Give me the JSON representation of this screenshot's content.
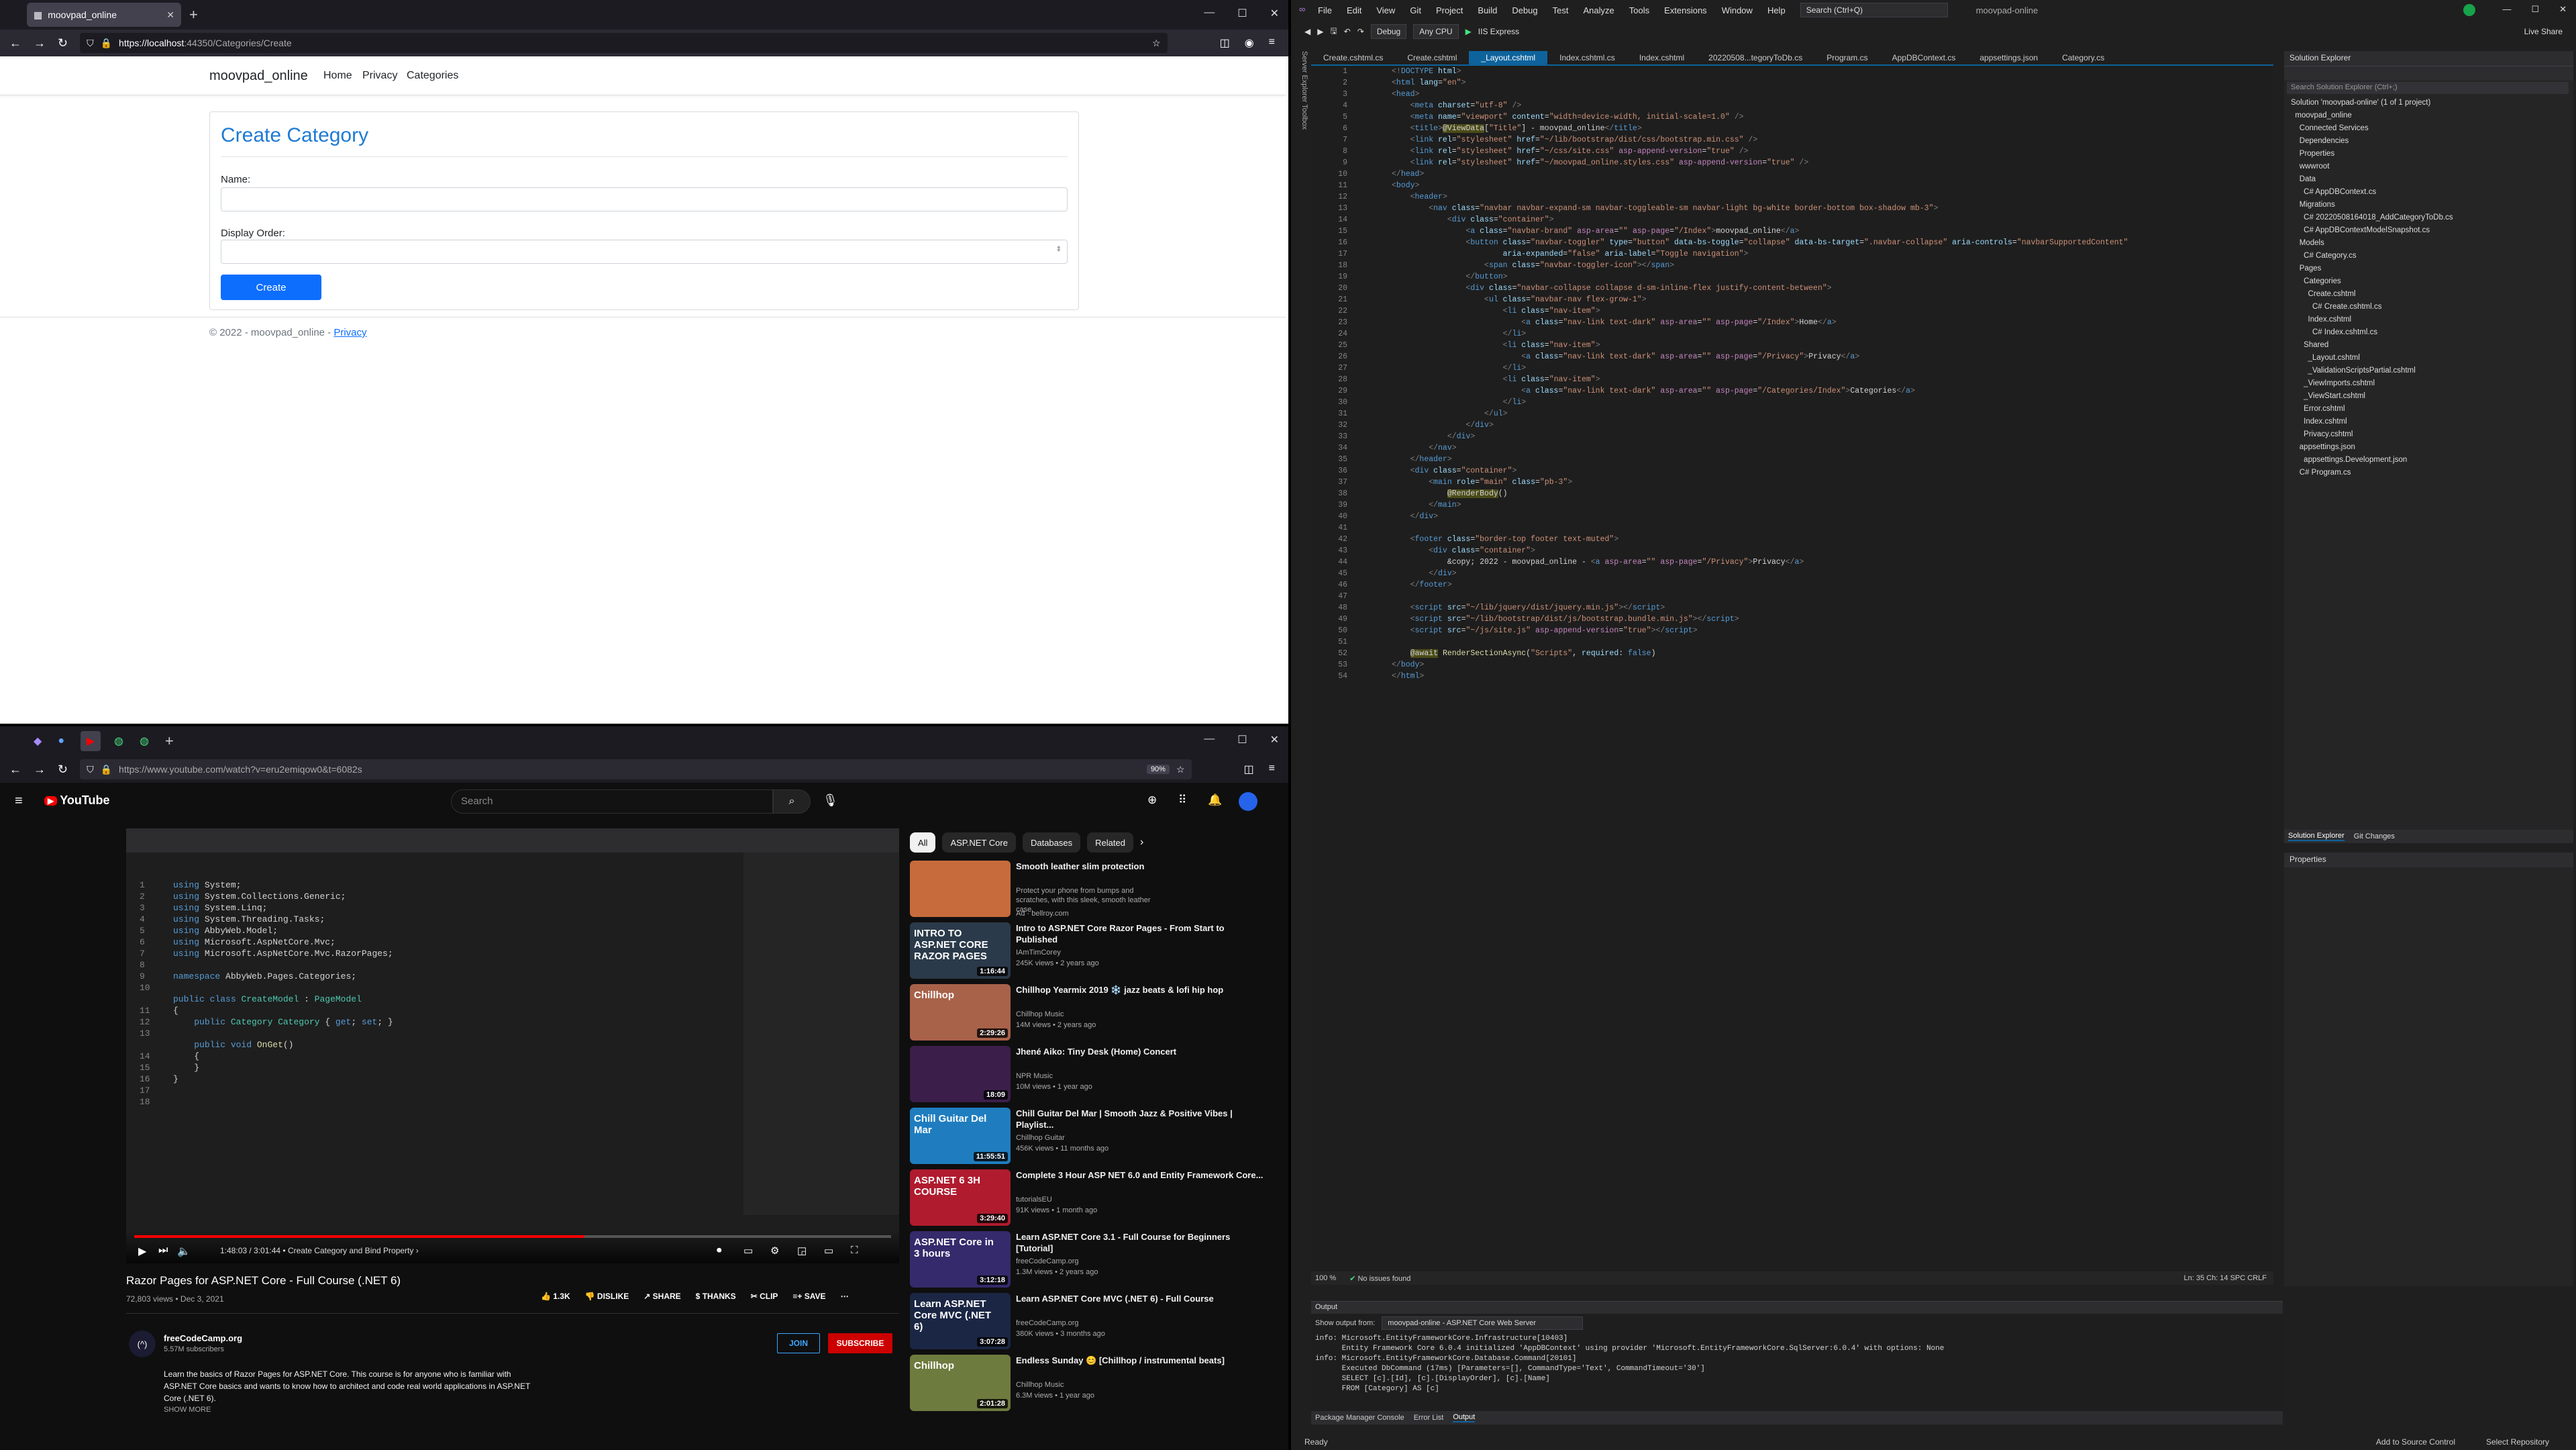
{
  "top_browser": {
    "tab_title": "moovpad_online",
    "url_host": "https://localhost",
    "url_rest": ":44350/Categories/Create",
    "page": {
      "brand": "moovpad_online",
      "nav": [
        "Home",
        "Privacy",
        "Categories"
      ],
      "heading": "Create Category",
      "name_label": "Name:",
      "order_label": "Display Order:",
      "create_button": "Create",
      "footer_text": "© 2022 - moovpad_online - ",
      "footer_link": "Privacy"
    }
  },
  "youtube": {
    "url": "https://www.youtube.com/watch?v=eru2emiqow0&t=6082s",
    "zoom": "90%",
    "search_placeholder": "Search",
    "chips": [
      "All",
      "ASP.NET Core",
      "Databases",
      "Related"
    ],
    "video_title": "Razor Pages for ASP.NET Core - Full Course (.NET 6)",
    "views": "72,803 views • Dec 3, 2021",
    "likes": "1.3K",
    "dislike": "DISLIKE",
    "share": "SHARE",
    "thanks": "THANKS",
    "clip": "CLIP",
    "save": "SAVE",
    "channel": "freeCodeCamp.org",
    "subscribers": "5.57M subscribers",
    "join": "JOIN",
    "subscribe": "SUBSCRIBE",
    "description": "Learn the basics of Razor Pages for ASP.NET Core. This course is for anyone who is familiar with ASP.NET Core basics and wants to know how to architect and code real world applications in ASP.NET Core (.NET 6).",
    "show_more": "SHOW MORE",
    "time": "1:48:03 / 3:01:44",
    "chapter": "Create Category and Bind Property",
    "recommendations": [
      {
        "title": "Smooth leather slim protection",
        "sub1": "Protect your phone from bumps and scratches, with this sleek, smooth leather case.",
        "sub2": "Ad · bellroy.com",
        "duration": "",
        "color": "#c86b3c",
        "thumb_text": ""
      },
      {
        "title": "Intro to ASP.NET Core Razor Pages - From Start to Published",
        "sub1": "IAmTimCorey",
        "sub2": "245K views • 2 years ago",
        "duration": "1:16:44",
        "color": "#2b3a4a",
        "thumb_text": "INTRO TO ASP.NET CORE RAZOR PAGES"
      },
      {
        "title": "Chillhop Yearmix 2019 ❄️ jazz beats & lofi hip hop",
        "sub1": "Chillhop Music",
        "sub2": "14M views • 2 years ago",
        "duration": "2:29:26",
        "color": "#a8624a",
        "thumb_text": "Chillhop"
      },
      {
        "title": "Jhené Aiko: Tiny Desk (Home) Concert",
        "sub1": "NPR Music",
        "sub2": "10M views • 1 year ago",
        "duration": "18:09",
        "color": "#3b1e4a",
        "thumb_text": ""
      },
      {
        "title": "Chill Guitar Del Mar | Smooth Jazz & Positive Vibes | Playlist...",
        "sub1": "Chillhop Guitar",
        "sub2": "456K views • 11 months ago",
        "duration": "11:55:51",
        "color": "#1f7dbf",
        "thumb_text": "Chill Guitar Del Mar"
      },
      {
        "title": "Complete 3 Hour ASP NET 6.0 and Entity Framework Core...",
        "sub1": "tutorialsEU",
        "sub2": "91K views • 1 month ago",
        "duration": "3:29:40",
        "color": "#b01b2e",
        "thumb_text": "ASP.NET 6 3H COURSE"
      },
      {
        "title": "Learn ASP.NET Core 3.1 - Full Course for Beginners [Tutorial]",
        "sub1": "freeCodeCamp.org",
        "sub2": "1.3M views • 2 years ago",
        "duration": "3:12:18",
        "color": "#352a6b",
        "thumb_text": "ASP.NET Core in 3 hours"
      },
      {
        "title": "Learn ASP.NET Core MVC (.NET 6) - Full Course",
        "sub1": "freeCodeCamp.org",
        "sub2": "380K views • 3 months ago",
        "duration": "3:07:28",
        "color": "#1b2644",
        "thumb_text": "Learn ASP.NET Core MVC (.NET 6)"
      },
      {
        "title": "Endless Sunday 😊 [Chillhop / instrumental beats]",
        "sub1": "Chillhop Music",
        "sub2": "6.3M views • 1 year ago",
        "duration": "2:01:28",
        "color": "#6d7b3e",
        "thumb_text": "Chillhop"
      }
    ]
  },
  "vs": {
    "menu": [
      "File",
      "Edit",
      "View",
      "Git",
      "Project",
      "Build",
      "Debug",
      "Test",
      "Analyze",
      "Tools",
      "Extensions",
      "Window",
      "Help"
    ],
    "search": "Search (Ctrl+Q)",
    "solution_name": "moovpad-online",
    "config": "Debug",
    "platform": "Any CPU",
    "run_target": "IIS Express",
    "live_share": "Live Share",
    "tabs": [
      "Create.cshtml.cs",
      "Create.cshtml",
      "_Layout.cshtml",
      "Index.cshtml.cs",
      "Index.cshtml",
      "20220508...tegoryToDb.cs",
      "Program.cs",
      "AppDBContext.cs",
      "appsettings.json",
      "Category.cs"
    ],
    "active_tab": 2,
    "zoom": "100 %",
    "issues": "No issues found",
    "cursor": "Ln: 35    Ch: 14    SPC    CRLF",
    "solution_explorer_title": "Solution Explorer",
    "solution_search": "Search Solution Explorer (Ctrl+;)",
    "tree": [
      "Solution 'moovpad-online' (1 of 1 project)",
      "  moovpad_online",
      "    Connected Services",
      "    Dependencies",
      "    Properties",
      "    wwwroot",
      "    Data",
      "      C# AppDBContext.cs",
      "    Migrations",
      "      C# 20220508164018_AddCategoryToDb.cs",
      "      C# AppDBContextModelSnapshot.cs",
      "    Models",
      "      C# Category.cs",
      "    Pages",
      "      Categories",
      "        Create.cshtml",
      "          C# Create.cshtml.cs",
      "        Index.cshtml",
      "          C# Index.cshtml.cs",
      "      Shared",
      "        _Layout.cshtml",
      "        _ValidationScriptsPartial.cshtml",
      "      _ViewImports.cshtml",
      "      _ViewStart.cshtml",
      "      Error.cshtml",
      "      Index.cshtml",
      "      Privacy.cshtml",
      "    appsettings.json",
      "      appsettings.Development.json",
      "    C# Program.cs"
    ],
    "sol_tabs": [
      "Solution Explorer",
      "Git Changes"
    ],
    "properties_title": "Properties",
    "output_title": "Output",
    "output_from": "Show output from:",
    "output_source": "moovpad-online - ASP.NET Core Web Server",
    "output_lines": [
      "info: Microsoft.EntityFrameworkCore.Infrastructure[10403]",
      "      Entity Framework Core 6.0.4 initialized 'AppDBContext' using provider 'Microsoft.EntityFrameworkCore.SqlServer:6.0.4' with options: None",
      "info: Microsoft.EntityFrameworkCore.Database.Command[20101]",
      "      Executed DbCommand (17ms) [Parameters=[], CommandType='Text', CommandTimeout='30']",
      "      SELECT [c].[Id], [c].[DisplayOrder], [c].[Name]",
      "      FROM [Category] AS [c]"
    ],
    "bottom_tabs": [
      "Package Manager Console",
      "Error List",
      "Output"
    ],
    "status": "Ready",
    "status_right": [
      "Add to Source Control",
      "Select Repository"
    ]
  }
}
